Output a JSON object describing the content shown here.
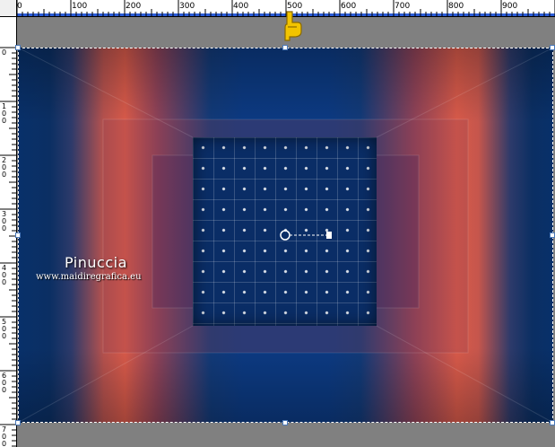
{
  "ruler": {
    "horizontal_labels": [
      "0",
      "100",
      "200",
      "300",
      "400",
      "500",
      "600",
      "700",
      "800",
      "900"
    ],
    "vertical_labels": [
      "0",
      "1 0 0",
      "2 0 0",
      "3 0 0",
      "4 0 0",
      "5 0 0",
      "6 0 0",
      "7 0 0"
    ]
  },
  "watermark": {
    "title": "Pinuccia",
    "url": "www.maidiregrafica.eu"
  },
  "colors": {
    "canvas_blue": "#0b2f6a",
    "canvas_orange": "#d85a4a",
    "workspace_gray": "#808080",
    "ruler_band_blue": "#2a5bd7",
    "pointer_yellow": "#f2c400"
  },
  "icons": {
    "pointer": "pointing-hand-icon",
    "pivot": "pivot-point-icon"
  }
}
